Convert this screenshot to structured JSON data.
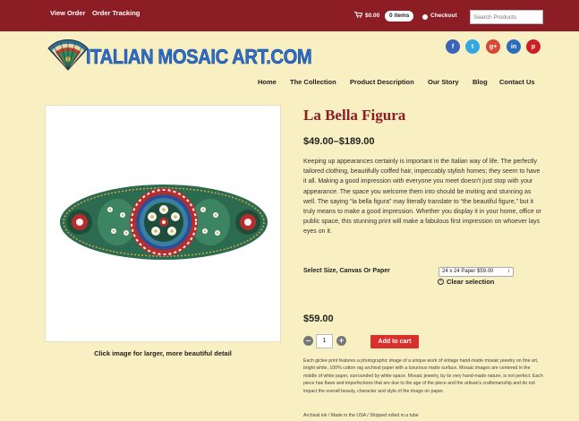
{
  "topbar": {
    "links": [
      "View Order",
      "Order Tracking"
    ],
    "cart_amount": "$0.00",
    "cart_items": "0 items",
    "checkout_label": "Checkout",
    "search_placeholder": "Search Products"
  },
  "header": {
    "logo_text": "ITALIAN MOSAIC ART.COM",
    "social": [
      {
        "name": "facebook",
        "glyph": "f",
        "color": "#3b63b8"
      },
      {
        "name": "twitter",
        "glyph": "t",
        "color": "#35a6e0"
      },
      {
        "name": "google-plus",
        "glyph": "g+",
        "color": "#d64937"
      },
      {
        "name": "linkedin",
        "glyph": "in",
        "color": "#2a6ebb"
      },
      {
        "name": "pinterest",
        "glyph": "p",
        "color": "#cb2027"
      }
    ]
  },
  "nav": [
    "Home",
    "The Collection",
    "Product Description",
    "Our Story",
    "Blog",
    "Contact Us"
  ],
  "product": {
    "title": "La Bella Figura",
    "price_range": "$49.00–$189.00",
    "description": "Keeping up appearances certainly is important in the Italian way of life. The perfectly tailored clothing, beautifully coiffed hair, impeccably stylish homes; they seem to have it all. Making a good impression with everyone you meet doesn't just stop with your appearance. The space you welcome them into should be inviting and stunning as well. The saying “la bella figura” may literally translate to “the beautiful figure,” but it truly means to make a good impression. Whether you display it in your home, office or public space, this stunning print will make a fabulous first impression on whoever lays eyes on it.",
    "image_caption": "Click image for larger, more beautiful detail",
    "select_label": "Select Size, Canvas Or Paper",
    "selected_option": "24 x 24 Paper $59.00",
    "clear_selection": "Clear selection",
    "price_single": "$59.00",
    "quantity": "1",
    "add_to_cart": "Add to cart",
    "fine_print": "Each giclee print features a photographic image of a unique work of vintage hand-made mosaic jewelry on fine art, bright white, 100% cotton rag archival paper with a luxurious matte surface. Mosaic images are centered in the middle of white paper, surrounded by white space. Mosaic jewelry, by its very hand-made nature, is not perfect. Each piece has flaws and imperfections that are due to the age of the piece and the artisan's craftsmanship and do not impact the overall beauty, character and style of the image on paper.",
    "shipping_note": "Archival ink / Made in the USA / Shipped rolled in a tube"
  }
}
